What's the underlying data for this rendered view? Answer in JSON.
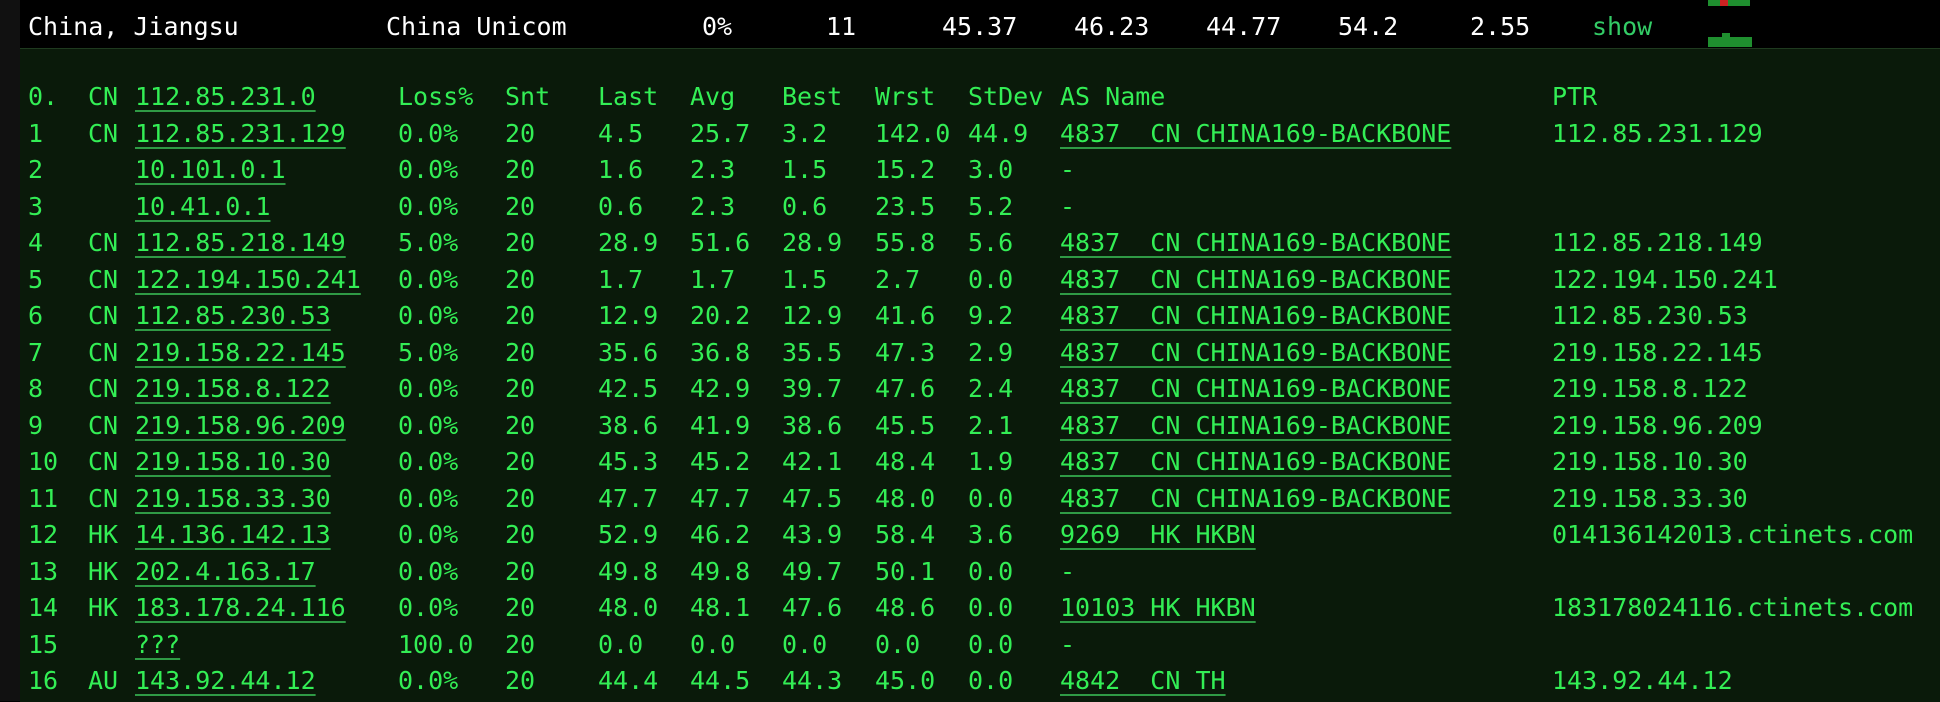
{
  "top_row": {
    "location": "China, Jiangsu",
    "isp": "China Unicom",
    "loss": "0%",
    "count": "11",
    "v1": "45.37",
    "v2": "46.23",
    "v3": "44.77",
    "v4": "54.2",
    "v5": "2.55",
    "show_link": "show"
  },
  "header": {
    "hop": "0.",
    "cc": "CN",
    "ip": "112.85.231.0",
    "loss": "Loss%",
    "snt": "Snt",
    "last": "Last",
    "avg": "Avg",
    "best": "Best",
    "wrst": "Wrst",
    "stdev": "StDev",
    "as_name": "AS Name",
    "ptr": "PTR"
  },
  "hops": [
    {
      "hop": "1",
      "cc": "CN",
      "ip": "112.85.231.129",
      "loss": "0.0%",
      "snt": "20",
      "last": "4.5",
      "avg": "25.7",
      "best": "3.2",
      "wrst": "142.0",
      "stdev": "44.9",
      "as_name": "4837  CN CHINA169-BACKBONE",
      "ptr": "112.85.231.129"
    },
    {
      "hop": "2",
      "cc": "",
      "ip": "10.101.0.1",
      "loss": "0.0%",
      "snt": "20",
      "last": "1.6",
      "avg": "2.3",
      "best": "1.5",
      "wrst": "15.2",
      "stdev": "3.0",
      "as_name": "-",
      "ptr": ""
    },
    {
      "hop": "3",
      "cc": "",
      "ip": "10.41.0.1",
      "loss": "0.0%",
      "snt": "20",
      "last": "0.6",
      "avg": "2.3",
      "best": "0.6",
      "wrst": "23.5",
      "stdev": "5.2",
      "as_name": "-",
      "ptr": ""
    },
    {
      "hop": "4",
      "cc": "CN",
      "ip": "112.85.218.149",
      "loss": "5.0%",
      "snt": "20",
      "last": "28.9",
      "avg": "51.6",
      "best": "28.9",
      "wrst": "55.8",
      "stdev": "5.6",
      "as_name": "4837  CN CHINA169-BACKBONE",
      "ptr": "112.85.218.149"
    },
    {
      "hop": "5",
      "cc": "CN",
      "ip": "122.194.150.241",
      "loss": "0.0%",
      "snt": "20",
      "last": "1.7",
      "avg": "1.7",
      "best": "1.5",
      "wrst": "2.7",
      "stdev": "0.0",
      "as_name": "4837  CN CHINA169-BACKBONE",
      "ptr": "122.194.150.241"
    },
    {
      "hop": "6",
      "cc": "CN",
      "ip": "112.85.230.53",
      "loss": "0.0%",
      "snt": "20",
      "last": "12.9",
      "avg": "20.2",
      "best": "12.9",
      "wrst": "41.6",
      "stdev": "9.2",
      "as_name": "4837  CN CHINA169-BACKBONE",
      "ptr": "112.85.230.53"
    },
    {
      "hop": "7",
      "cc": "CN",
      "ip": "219.158.22.145",
      "loss": "5.0%",
      "snt": "20",
      "last": "35.6",
      "avg": "36.8",
      "best": "35.5",
      "wrst": "47.3",
      "stdev": "2.9",
      "as_name": "4837  CN CHINA169-BACKBONE",
      "ptr": "219.158.22.145"
    },
    {
      "hop": "8",
      "cc": "CN",
      "ip": "219.158.8.122",
      "loss": "0.0%",
      "snt": "20",
      "last": "42.5",
      "avg": "42.9",
      "best": "39.7",
      "wrst": "47.6",
      "stdev": "2.4",
      "as_name": "4837  CN CHINA169-BACKBONE",
      "ptr": "219.158.8.122"
    },
    {
      "hop": "9",
      "cc": "CN",
      "ip": "219.158.96.209",
      "loss": "0.0%",
      "snt": "20",
      "last": "38.6",
      "avg": "41.9",
      "best": "38.6",
      "wrst": "45.5",
      "stdev": "2.1",
      "as_name": "4837  CN CHINA169-BACKBONE",
      "ptr": "219.158.96.209"
    },
    {
      "hop": "10",
      "cc": "CN",
      "ip": "219.158.10.30",
      "loss": "0.0%",
      "snt": "20",
      "last": "45.3",
      "avg": "45.2",
      "best": "42.1",
      "wrst": "48.4",
      "stdev": "1.9",
      "as_name": "4837  CN CHINA169-BACKBONE",
      "ptr": "219.158.10.30"
    },
    {
      "hop": "11",
      "cc": "CN",
      "ip": "219.158.33.30",
      "loss": "0.0%",
      "snt": "20",
      "last": "47.7",
      "avg": "47.7",
      "best": "47.5",
      "wrst": "48.0",
      "stdev": "0.0",
      "as_name": "4837  CN CHINA169-BACKBONE",
      "ptr": "219.158.33.30"
    },
    {
      "hop": "12",
      "cc": "HK",
      "ip": "14.136.142.13",
      "loss": "0.0%",
      "snt": "20",
      "last": "52.9",
      "avg": "46.2",
      "best": "43.9",
      "wrst": "58.4",
      "stdev": "3.6",
      "as_name": "9269  HK HKBN",
      "ptr": "014136142013.ctinets.com"
    },
    {
      "hop": "13",
      "cc": "HK",
      "ip": "202.4.163.17",
      "loss": "0.0%",
      "snt": "20",
      "last": "49.8",
      "avg": "49.8",
      "best": "49.7",
      "wrst": "50.1",
      "stdev": "0.0",
      "as_name": "-",
      "ptr": ""
    },
    {
      "hop": "14",
      "cc": "HK",
      "ip": "183.178.24.116",
      "loss": "0.0%",
      "snt": "20",
      "last": "48.0",
      "avg": "48.1",
      "best": "47.6",
      "wrst": "48.6",
      "stdev": "0.0",
      "as_name": "10103 HK HKBN",
      "ptr": "183178024116.ctinets.com"
    },
    {
      "hop": "15",
      "cc": "",
      "ip": "???",
      "loss": "100.0",
      "snt": "20",
      "last": "0.0",
      "avg": "0.0",
      "best": "0.0",
      "wrst": "0.0",
      "stdev": "0.0",
      "as_name": "-",
      "ptr": ""
    },
    {
      "hop": "16",
      "cc": "AU",
      "ip": "143.92.44.12",
      "loss": "0.0%",
      "snt": "20",
      "last": "44.4",
      "avg": "44.5",
      "best": "44.3",
      "wrst": "45.0",
      "stdev": "0.0",
      "as_name": "4842  CN TH",
      "ptr": "143.92.44.12"
    }
  ]
}
